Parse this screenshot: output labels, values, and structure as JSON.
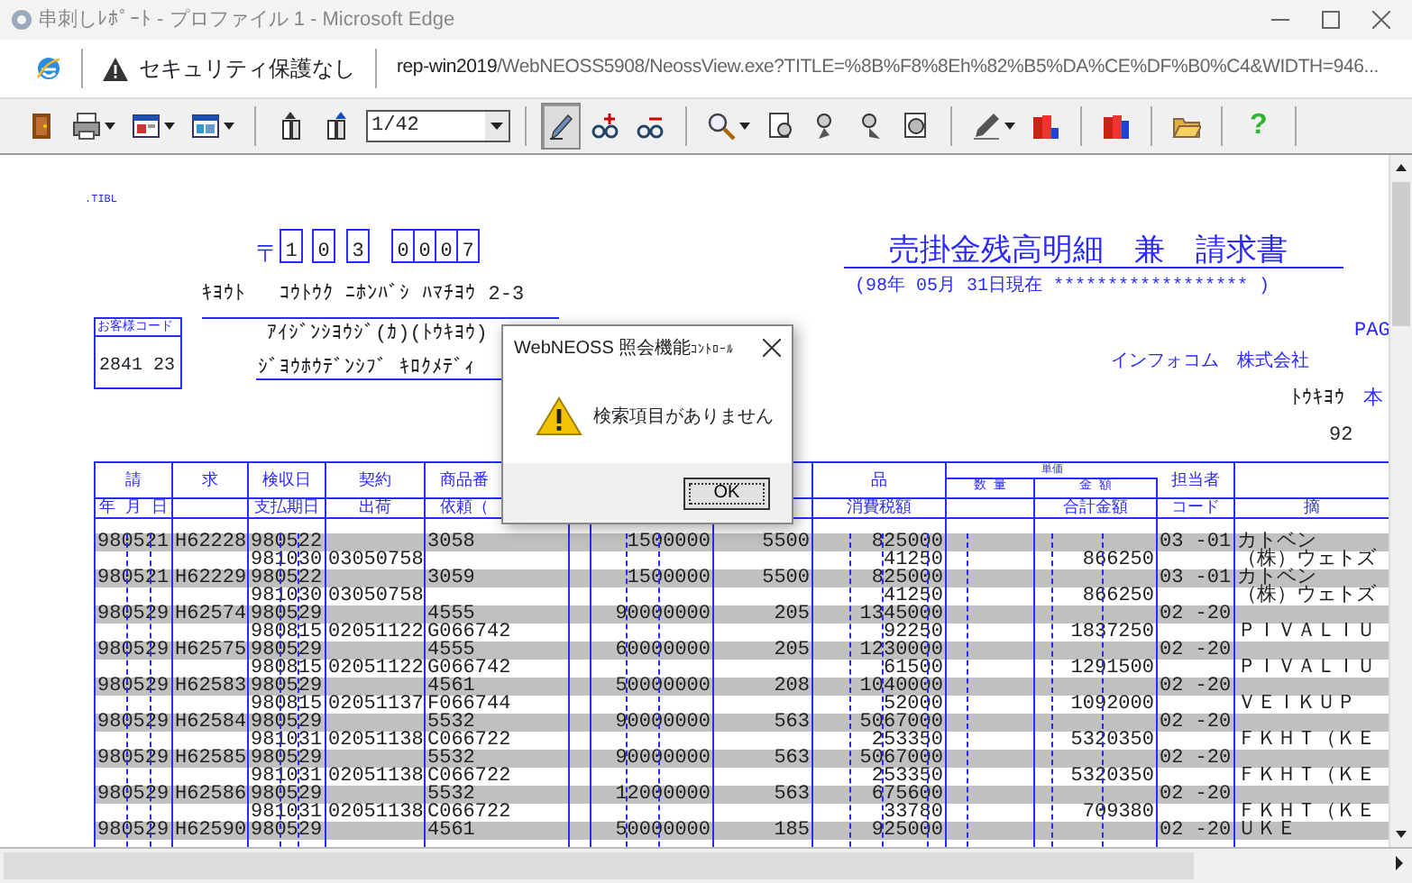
{
  "window": {
    "title": "串刺しﾚﾎﾟｰﾄ - プロファイル 1 - Microsoft Edge"
  },
  "address_bar": {
    "security": "セキュリティ保護なし",
    "host": "rep-win2019",
    "path": "/WebNEOSS5908/NeossView.exe?TITLE=%8B%F8%8Eh%82%B5%DA%CE%DF%B0%C4&WIDTH=946..."
  },
  "toolbar": {
    "groups": [
      [
        {
          "kind": "tool",
          "selected": false,
          "menu": false
        },
        {
          "kind": "tool",
          "selected": false,
          "menu": true
        },
        {
          "kind": "tool",
          "selected": false,
          "menu": true
        },
        {
          "kind": "tool",
          "selected": false,
          "menu": true
        }
      ],
      [
        {
          "kind": "tool",
          "selected": false,
          "menu": false
        },
        {
          "kind": "tool",
          "selected": false,
          "menu": false
        },
        {
          "kind": "select",
          "value": "1/42"
        }
      ],
      [
        {
          "kind": "tool",
          "selected": true,
          "menu": false
        },
        {
          "kind": "tool",
          "selected": false,
          "menu": false
        },
        {
          "kind": "tool",
          "selected": false,
          "menu": false
        }
      ],
      [
        {
          "kind": "tool",
          "selected": false,
          "menu": true
        },
        {
          "kind": "tool",
          "selected": false,
          "menu": false
        },
        {
          "kind": "tool",
          "selected": false,
          "menu": false
        },
        {
          "kind": "tool",
          "selected": false,
          "menu": false
        },
        {
          "kind": "tool",
          "selected": false,
          "menu": false
        }
      ],
      [
        {
          "kind": "tool",
          "selected": false,
          "menu": true
        },
        {
          "kind": "tool",
          "selected": false,
          "menu": false
        }
      ],
      [
        {
          "kind": "tool",
          "selected": false,
          "menu": false
        }
      ],
      [
        {
          "kind": "tool",
          "selected": false,
          "menu": false
        }
      ],
      [
        {
          "kind": "help",
          "label": "?"
        }
      ]
    ]
  },
  "report": {
    "tag": ".TIBL",
    "postal_mark": "〒",
    "postal_digits": [
      "1",
      "0",
      "3",
      "0",
      "0",
      "0",
      "7"
    ],
    "city": "ｷﾖｳﾄ",
    "address": "ｺｳﾄｳｸ ﾆﾎﾝﾊﾞｼ ﾊﾏﾁﾖｳ 2-3",
    "customer_code_label": "お客様コード",
    "customer_code": "2841 23",
    "recipient_lines": [
      "ｱｲｼﾞﾝｼﾖｳｼﾞ(ｶ)(ﾄｳｷﾖｳ)",
      "ｼﾞﾖｳﾎｳﾃﾞﾝｼﾌﾞ ｷﾛｸﾒﾃﾞｨ"
    ],
    "title": "売掛金残高明細　兼　請求書",
    "as_of": "(98年 05月 31日現在 ****************** )",
    "page_label": "PAG",
    "company": "インフォコム　株式会社",
    "branch": "ﾄｳｷﾖｳ",
    "branch_suffix": "本",
    "number": "92"
  },
  "table": {
    "headers_left": [
      {
        "top": "請",
        "bottom": "年 月 日"
      },
      {
        "top": "求"
      },
      {
        "top": "検収日",
        "bottom": "支払期日"
      },
      {
        "top": "契約",
        "bottom": "出荷"
      },
      {
        "top": "商品番",
        "bottom": "依頼（"
      }
    ],
    "headers_right": [
      {
        "top": "品",
        "bottom": "消費税額"
      },
      {
        "top": "数 量"
      },
      {
        "top": "金 額",
        "bottom": "合計金額"
      },
      {
        "top": "担当者",
        "bottom": "コード"
      },
      {
        "bottom": "摘"
      }
    ],
    "unit_group": "単価",
    "rows": [
      {
        "date": "980521",
        "number": "H62228",
        "inspection": "980522",
        "product": "3058",
        "amount": "1500000",
        "quantity": "5500",
        "price": "825000",
        "staff": "03 -01",
        "remark": "カトベン",
        "due": "981030",
        "contract": "03050758",
        "tax": "41250",
        "total": "866250",
        "remark2": "（株）ウェトズ"
      },
      {
        "date": "980521",
        "number": "H62229",
        "inspection": "980522",
        "product": "3059",
        "amount": "1500000",
        "quantity": "5500",
        "price": "825000",
        "staff": "03 -01",
        "remark": "カトベン",
        "due": "981030",
        "contract": "03050758",
        "tax": "41250",
        "total": "866250",
        "remark2": "（株）ウェトズ"
      },
      {
        "date": "980529",
        "number": "H62574",
        "inspection": "980529",
        "product": "4555",
        "amount": "90000000",
        "quantity": "205",
        "price": "1345000",
        "staff": "02 -20",
        "due": "980815",
        "contract": "02051122",
        "item_code": "G066742",
        "tax": "92250",
        "total": "1837250",
        "remark2": "ＰＩＶＡＬＩＵ"
      },
      {
        "date": "980529",
        "number": "H62575",
        "inspection": "980529",
        "product": "4555",
        "amount": "60000000",
        "quantity": "205",
        "price": "1230000",
        "staff": "02 -20",
        "due": "980815",
        "contract": "02051122",
        "item_code": "G066742",
        "tax": "61500",
        "total": "1291500",
        "remark2": "ＰＩＶＡＬＩＵ"
      },
      {
        "date": "980529",
        "number": "H62583",
        "inspection": "980529",
        "product": "4561",
        "amount": "50000000",
        "quantity": "208",
        "price": "1040000",
        "staff": "02 -20",
        "due": "980815",
        "contract": "02051137",
        "item_code": "F066744",
        "tax": "52000",
        "total": "1092000",
        "remark2": "ＶＥＩＫＵＰ"
      },
      {
        "date": "980529",
        "number": "H62584",
        "inspection": "980529",
        "product": "5532",
        "amount": "90000000",
        "quantity": "563",
        "price": "5067000",
        "staff": "02 -20",
        "due": "981031",
        "contract": "02051138",
        "item_code": "C066722",
        "tax": "253350",
        "total": "5320350",
        "remark2": "ＦＫＨＴ（ＫＥ"
      },
      {
        "date": "980529",
        "number": "H62585",
        "inspection": "980529",
        "product": "5532",
        "amount": "90000000",
        "quantity": "563",
        "price": "5067000",
        "staff": "02 -20",
        "due": "981031",
        "contract": "02051138",
        "item_code": "C066722",
        "tax": "253350",
        "total": "5320350",
        "remark2": "ＦＫＨＴ（ＫＥ"
      },
      {
        "date": "980529",
        "number": "H62586",
        "inspection": "980529",
        "product": "5532",
        "amount": "12000000",
        "quantity": "563",
        "price": "675600",
        "staff": "02 -20",
        "due": "981031",
        "contract": "02051138",
        "item_code": "C066722",
        "tax": "33780",
        "total": "709380",
        "remark2": "ＦＫＨＴ（ＫＥ"
      },
      {
        "date": "980529",
        "number": "H62590",
        "inspection": "980529",
        "product": "4561",
        "amount": "50000000",
        "quantity": "185",
        "price": "925000",
        "staff": "02 -20",
        "remark": "ＵＫＥ"
      }
    ]
  },
  "dialog": {
    "title": "WebNEOSS 照会機能",
    "title_suffix": "ｺﾝﾄﾛｰﾙ",
    "message": "検索項目がありません",
    "button": "OK"
  }
}
